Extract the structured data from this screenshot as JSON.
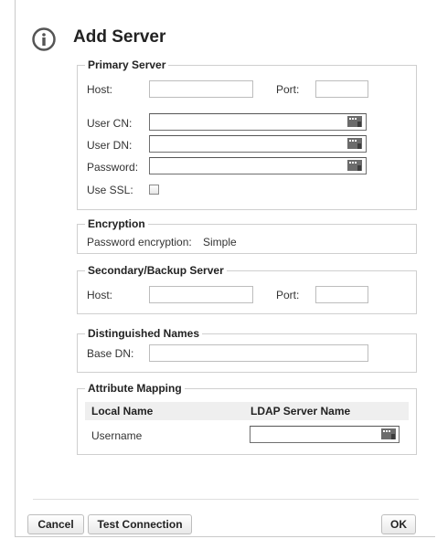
{
  "dialog": {
    "title": "Add Server",
    "icon": "info-icon"
  },
  "primary_server": {
    "legend": "Primary Server",
    "host_label": "Host:",
    "port_label": "Port:",
    "user_cn_label": "User CN:",
    "user_dn_label": "User DN:",
    "password_label": "Password:",
    "use_ssl_label": "Use SSL:"
  },
  "encryption": {
    "legend": "Encryption",
    "password_encryption_label": "Password encryption:",
    "password_encryption_value": "Simple"
  },
  "secondary_server": {
    "legend": "Secondary/Backup Server",
    "host_label": "Host:",
    "port_label": "Port:"
  },
  "distinguished_names": {
    "legend": "Distinguished Names",
    "base_dn_label": "Base DN:"
  },
  "attribute_mapping": {
    "legend": "Attribute Mapping",
    "col_local": "Local Name",
    "col_ldap": "LDAP Server Name",
    "rows": [
      {
        "local": "Username"
      }
    ]
  },
  "buttons": {
    "cancel": "Cancel",
    "test_connection": "Test Connection",
    "ok": "OK"
  }
}
